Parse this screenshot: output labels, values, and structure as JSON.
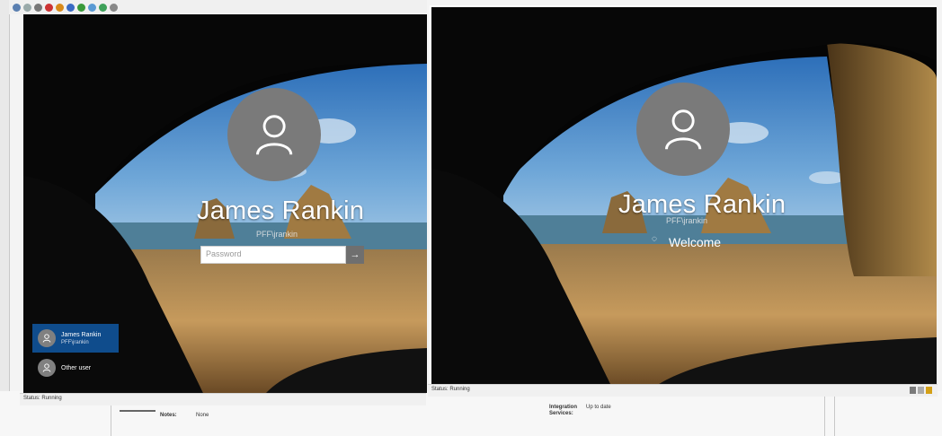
{
  "window_left": {
    "user": {
      "name": "James Rankin",
      "domain": "PFF\\jrankin"
    },
    "password": {
      "placeholder": "Password"
    },
    "user_list": [
      {
        "name": "James Rankin",
        "sub": "PFF\\jrankin"
      },
      {
        "name": "Other user",
        "sub": ""
      }
    ],
    "status": "Status: Running"
  },
  "window_right": {
    "user": {
      "name": "James Rankin",
      "domain": "PFF\\jrankin"
    },
    "welcome": "Welcome",
    "status": "Status: Running"
  },
  "details": {
    "label_left": "Notes:",
    "value_left": "None",
    "integration_label": "Integration",
    "services_label": "Services:",
    "integration_value": "Up to date"
  },
  "colors": {
    "selected_tile": "#0f4c8c",
    "avatar": "#7a7a7a"
  }
}
